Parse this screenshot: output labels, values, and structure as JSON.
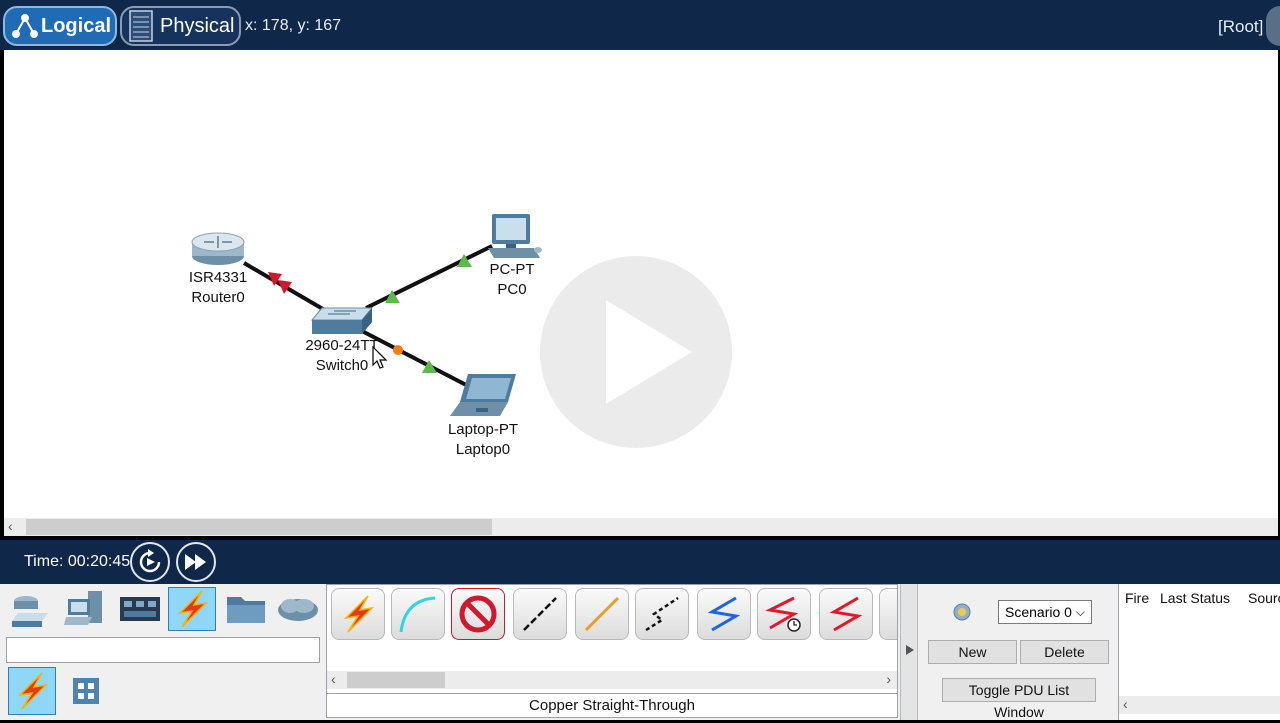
{
  "topbar": {
    "logical_label": "Logical",
    "physical_label": "Physical",
    "coords": "x: 178, y: 167",
    "root_label": "[Root]"
  },
  "devices": [
    {
      "model": "ISR4331",
      "name": "Router0"
    },
    {
      "model": "PC-PT",
      "name": "PC0"
    },
    {
      "model": "2960-24TT",
      "name": "Switch0"
    },
    {
      "model": "Laptop-PT",
      "name": "Laptop0"
    }
  ],
  "timebar": {
    "time_label": "Time: 00:20:45"
  },
  "connections": {
    "selected_name": "Copper Straight-Through"
  },
  "scenario": {
    "selected": "Scenario 0",
    "new_label": "New",
    "delete_label": "Delete",
    "toggle_label": "Toggle PDU List Window"
  },
  "pdu_list": {
    "col_fire": "Fire",
    "col_last_status": "Last Status",
    "col_source": "Sourc"
  },
  "colors": {
    "bar_bg": "#0f2748",
    "link_up": "#5cb94a",
    "link_down": "#d0182e",
    "link_pending": "#f07d10"
  }
}
